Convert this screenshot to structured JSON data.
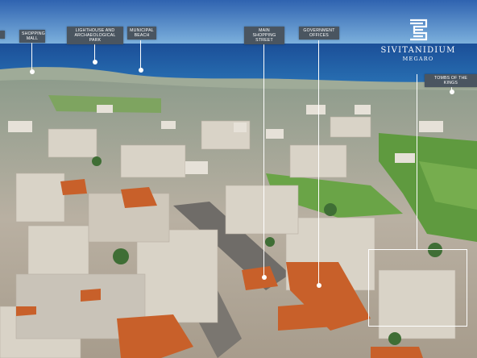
{
  "labels": {
    "left_cut": "...",
    "shopping_mall": "SHOPPING MALL",
    "lighthouse_park": "LIGHTHOUSE AND ARCHAEOLOGICAL PARK",
    "municipal_beach": "MUNICIPAL BEACH",
    "main_shopping_street": "MAIN SHOPPING STREET",
    "government_offices": "GOVERNMENT OFFICES",
    "tombs_of_kings": "TOMBS OF THE KINGS"
  },
  "brand": {
    "name": "SIVITANIDIUM",
    "subtitle": "MEGARO",
    "logo_icon": "stacked-s-logo-icon"
  },
  "colors": {
    "label_bg": "#4a5560",
    "label_text": "#ffffff",
    "sky": "#5b93c9",
    "sea": "#1f5fa8"
  }
}
